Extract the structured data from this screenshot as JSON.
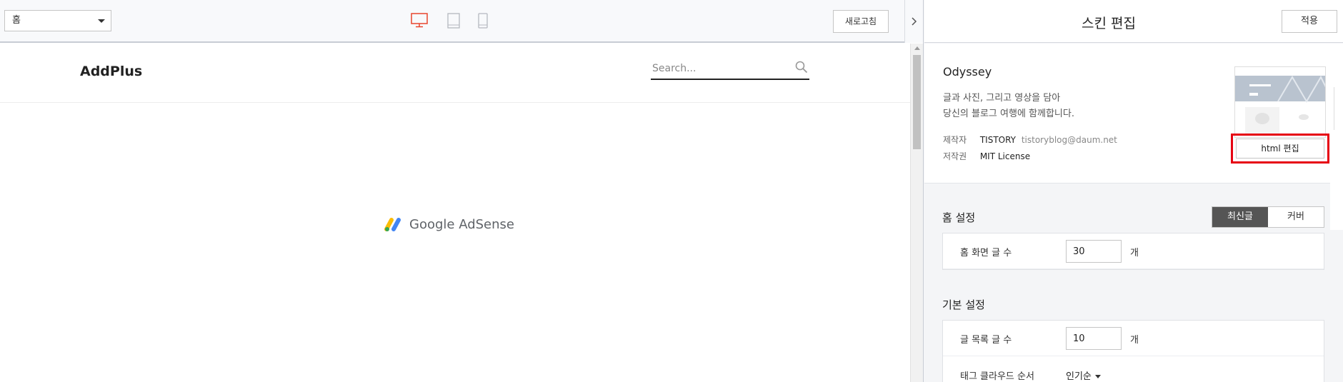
{
  "toolbar": {
    "page_select_value": "홈",
    "refresh_label": "새로고침",
    "active_device_color": "#e8452c"
  },
  "preview": {
    "blog_logo": "AddPlus",
    "search_placeholder": "Search...",
    "ad_text": "Google AdSense"
  },
  "editor": {
    "title": "스킨 편집",
    "apply_label": "적용",
    "skin": {
      "name": "Odyssey",
      "desc_line1": "글과 사진, 그리고 영상을 담아",
      "desc_line2": "당신의 블로그 여행에 함께합니다.",
      "author_label": "제작자",
      "author_value": "TISTORY",
      "author_email": "tistoryblog@daum.net",
      "license_label": "저작권",
      "license_value": "MIT License",
      "html_edit_label": "html 편집"
    },
    "home_settings": {
      "title": "홈 설정",
      "seg_options": [
        "최신글",
        "커버"
      ],
      "seg_active": "최신글",
      "post_count_label": "홈 화면 글 수",
      "post_count_value": "30",
      "unit": "개"
    },
    "basic_settings": {
      "title": "기본 설정",
      "list_count_label": "글 목록 글 수",
      "list_count_value": "10",
      "unit": "개",
      "tag_cloud_label": "태그 클라우드 순서",
      "tag_cloud_value": "인기순"
    }
  }
}
